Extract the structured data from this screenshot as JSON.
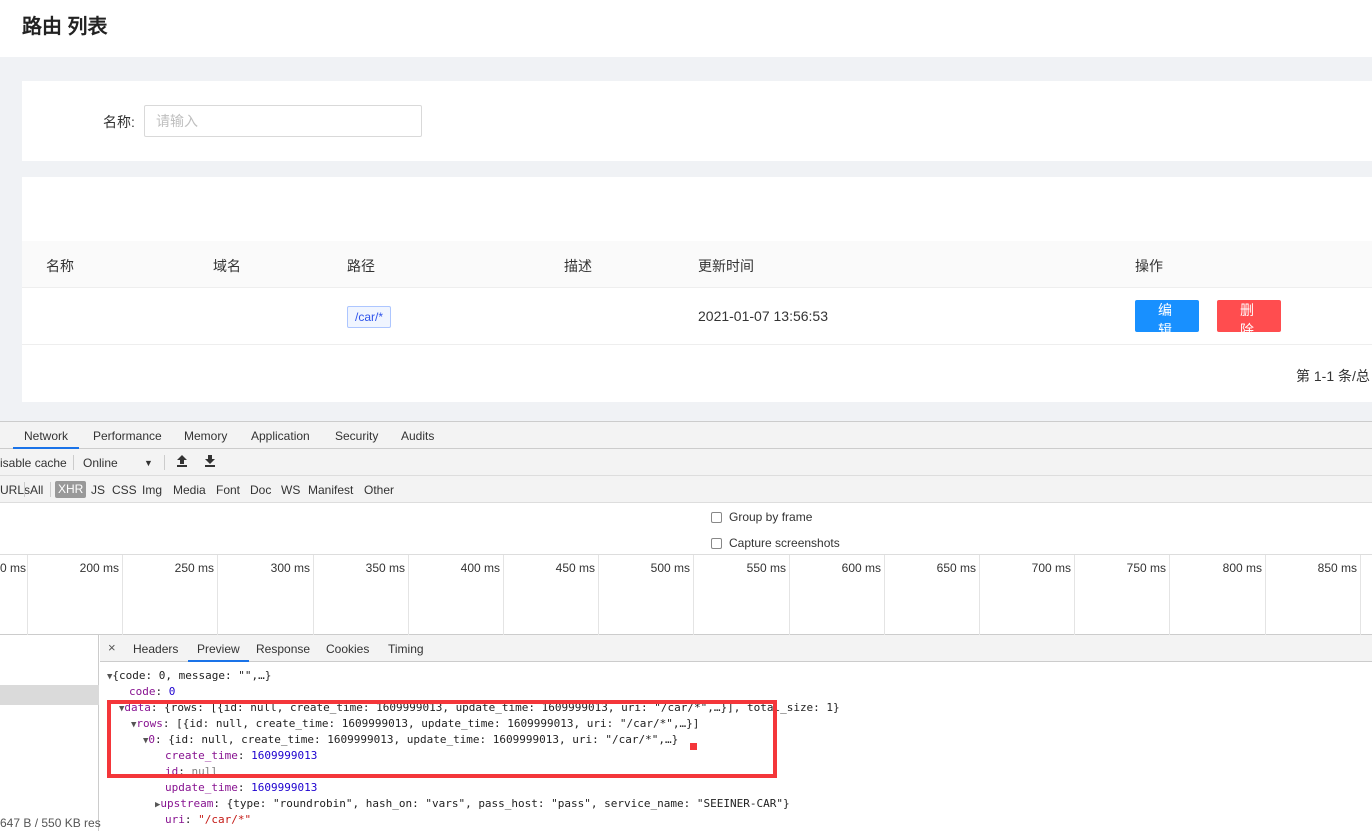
{
  "page": {
    "title": "路由 列表"
  },
  "search": {
    "label": "名称:",
    "placeholder": "请输入",
    "value": ""
  },
  "table": {
    "headers": [
      "名称",
      "域名",
      "路径",
      "描述",
      "更新时间",
      "操作"
    ],
    "rows": [
      {
        "name": "",
        "host": "",
        "path": "/car/*",
        "desc": "",
        "updated": "2021-01-07 13:56:53",
        "edit_label": "编辑",
        "delete_label": "删除"
      }
    ],
    "pagination": "第 1-1 条/总"
  },
  "devtools": {
    "tabs": [
      "Network",
      "Performance",
      "Memory",
      "Application",
      "Security",
      "Audits"
    ],
    "active_tab": "Network",
    "toolbar": {
      "disable_cache": "isable cache",
      "throttle": "Online",
      "throttle_arrow": "▼",
      "import_icon": "upload-icon",
      "export_icon": "download-icon"
    },
    "filters": [
      "URLs",
      "All",
      "XHR",
      "JS",
      "CSS",
      "Img",
      "Media",
      "Font",
      "Doc",
      "WS",
      "Manifest",
      "Other"
    ],
    "active_filter": "XHR",
    "options": {
      "group_by_frame": "Group by frame",
      "capture_screenshots": "Capture screenshots"
    },
    "timeline_ticks": [
      "0 ms",
      "200 ms",
      "250 ms",
      "300 ms",
      "350 ms",
      "400 ms",
      "450 ms",
      "500 ms",
      "550 ms",
      "600 ms",
      "650 ms",
      "700 ms",
      "750 ms",
      "800 ms",
      "850 ms"
    ],
    "status": "647 B / 550 KB res",
    "preview_tabs": [
      "Headers",
      "Preview",
      "Response",
      "Cookies",
      "Timing"
    ],
    "active_preview_tab": "Preview",
    "close": "×",
    "json_lines": {
      "root": "{code: 0, message: \"\",…}",
      "code_key": "code",
      "code_val": "0",
      "data_key": "data",
      "data_val": "{rows: [{id: null, create_time: 1609999013, update_time: 1609999013, uri: \"/car/*\",…}], total_size: 1}",
      "rows_key": "rows",
      "rows_val": "[{id: null, create_time: 1609999013, update_time: 1609999013, uri: \"/car/*\",…}]",
      "item0_key": "0",
      "item0_val": "{id: null, create_time: 1609999013, update_time: 1609999013, uri: \"/car/*\",…}",
      "create_time_key": "create_time",
      "create_time_val": "1609999013",
      "id_key": "id",
      "id_val": "null",
      "update_time_key": "update_time",
      "update_time_val": "1609999013",
      "upstream_key": "upstream",
      "upstream_val": "{type: \"roundrobin\", hash_on: \"vars\", pass_host: \"pass\", service_name: \"SEEINER-CAR\"}",
      "uri_key": "uri",
      "uri_val": "\"/car/*\""
    }
  },
  "colors": {
    "primary": "#1890ff",
    "danger": "#ff4d4f",
    "highlight": "#f4363a"
  }
}
